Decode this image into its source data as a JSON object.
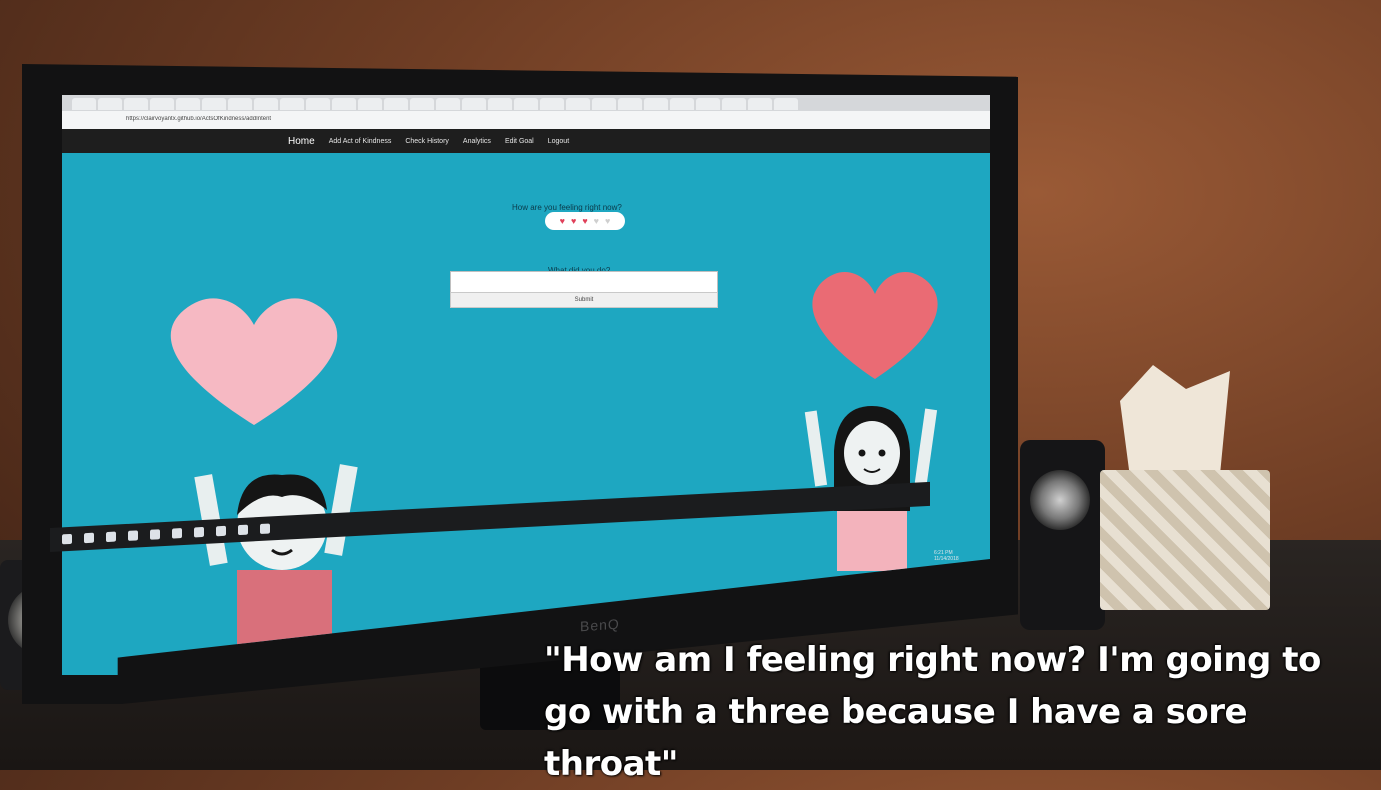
{
  "browser": {
    "url": "https://clairvoyantx.github.io/ActsOfKindness/addIntent"
  },
  "nav": {
    "home": "Home",
    "add_act": "Add Act of Kindness",
    "check_history": "Check History",
    "analytics": "Analytics",
    "edit_goal": "Edit Goal",
    "logout": "Logout"
  },
  "mood": {
    "question": "How are you feeling right now?",
    "rating": 3,
    "max": 5,
    "filled_heart": "♥",
    "empty_heart": "♥"
  },
  "action": {
    "prompt": "What did you do?",
    "submit_label": "Submit"
  },
  "monitor": {
    "brand": "BenQ"
  },
  "taskbar": {
    "time": "6:21 PM",
    "date": "11/14/2018"
  },
  "caption": {
    "text": "\"How am I feeling right now? I'm going to go with a three because I have a sore throat\""
  },
  "colors": {
    "page_background": "#1ea7c1",
    "heart_pink": "#f6b9c3",
    "heart_red": "#ea6b74",
    "nav_background": "#1e1e1e"
  }
}
